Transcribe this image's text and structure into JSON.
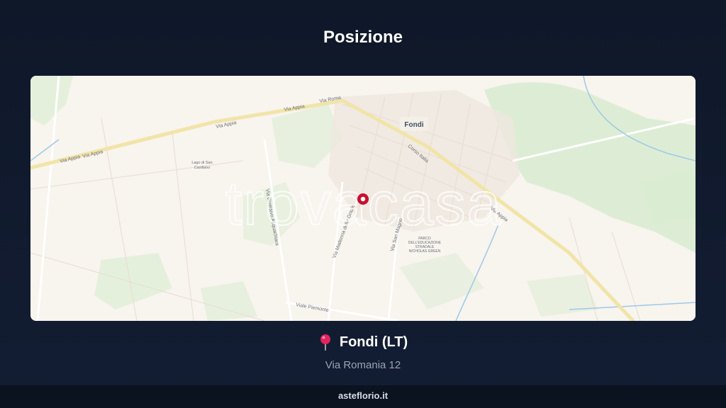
{
  "header": {
    "title": "Posizione"
  },
  "map": {
    "city_label": "Fondi",
    "watermark": "trovacasa",
    "streets": {
      "via_appia_1": "Via Appia",
      "via_appia_2": "Via Appia",
      "via_appia_3": "Via Appia",
      "via_appia_4": "Via Appia",
      "via_roma": "Via Roma",
      "corso_italia": "Corso Italia",
      "via_diversivo": "Via Diversivo Acquachiara",
      "via_madonna": "Via Madonna delle Grazie",
      "via_san_magno": "Via San Magno",
      "viale_piemonte": "Viale Piemonte",
      "via_appia_east": "Via Appia"
    },
    "poi": {
      "lago_line1": "Lago di San",
      "lago_line2": "Casiliano",
      "parco_line1": "PARCO",
      "parco_line2": "DELL'EDUCAZIONE",
      "parco_line3": "STRADALE",
      "parco_line4": "NICHOLAS GREEN"
    },
    "colors": {
      "land": "#f8f4ee",
      "green": "#d7ebcf",
      "road": "#f2e7b5",
      "marker": "#c8102e"
    }
  },
  "location": {
    "pin_icon": "round-pushpin",
    "city": "Fondi (LT)",
    "address": "Via Romania 12"
  },
  "footer": {
    "brand": "asteflorio.it"
  }
}
